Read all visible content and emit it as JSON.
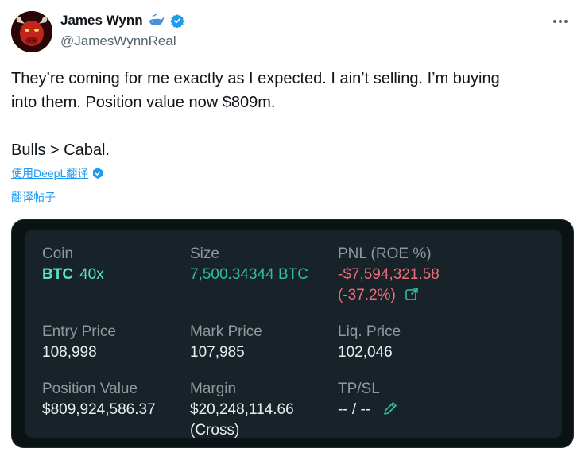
{
  "author": {
    "display_name": "James Wynn",
    "handle": "@JamesWynnReal",
    "badge_icons": [
      "whale-icon",
      "verified-icon"
    ]
  },
  "tweet": {
    "line1": "They’re coming for me exactly as I expected. I ain’t selling. I’m buying",
    "line2": "into them. Position value now $809m.",
    "line3": "Bulls > Cabal."
  },
  "translate": {
    "deepl_label": "使用DeepL翻译",
    "post_label": "翻译帖子"
  },
  "position_card": {
    "coin_label": "Coin",
    "coin_value": "BTC",
    "leverage": "40x",
    "size_label": "Size",
    "size_value": "7,500.34344 BTC",
    "pnl_label": "PNL (ROE %)",
    "pnl_value": "-$7,594,321.58",
    "roe_value": "(-37.2%)",
    "entry_label": "Entry Price",
    "entry_value": "108,998",
    "mark_label": "Mark Price",
    "mark_value": "107,985",
    "liq_label": "Liq. Price",
    "liq_value": "102,046",
    "position_value_label": "Position Value",
    "position_value": "$809,924,586.37",
    "margin_label": "Margin",
    "margin_value": "$20,248,114.66",
    "margin_mode": "(Cross)",
    "tpsl_label": "TP/SL",
    "tpsl_value": "-- / --"
  },
  "colors": {
    "link": "#1d9bf0",
    "card_bg": "#172328",
    "accent_teal": "#5ce0c8",
    "positive_green": "#2fbf9a",
    "negative_red": "#ef6b78"
  }
}
